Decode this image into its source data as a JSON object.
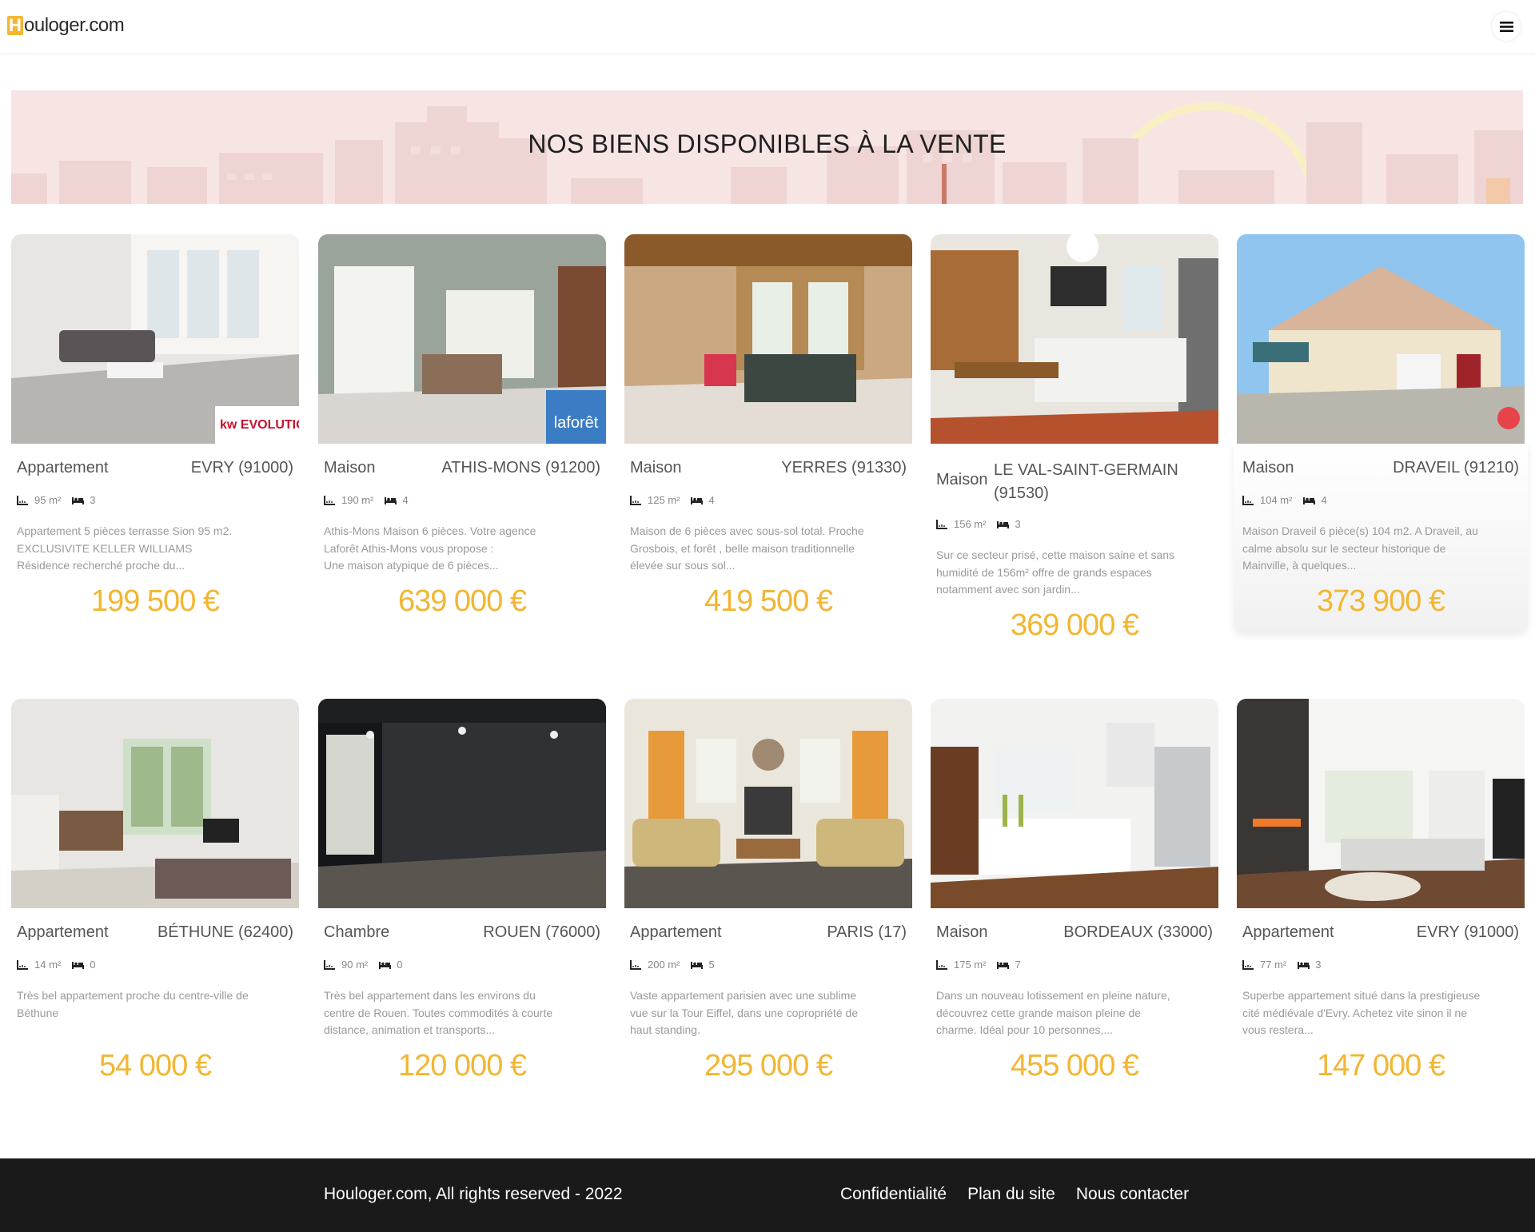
{
  "header": {
    "logo_mark": "H",
    "logo_text": "ouloger.com",
    "menu_icon": "hamburger-icon"
  },
  "banner": {
    "title": "NOS BIENS DISPONIBLES À LA VENTE"
  },
  "colors": {
    "accent": "#f2b632",
    "footer_bg": "#1a1a1a",
    "banner_bg": "#f7e4e3"
  },
  "listings": [
    {
      "type": "Appartement",
      "city": "EVRY (91000)",
      "area": "95 m²",
      "rooms": "3",
      "desc": [
        "Appartement 5 pièces terrasse Sion 95 m2.",
        "EXCLUSIVITE KELLER WILLIAMS",
        "Résidence recherché proche du..."
      ],
      "price": "199 500 €",
      "badge": "kw EVOLUTION"
    },
    {
      "type": "Maison",
      "city": "ATHIS-MONS (91200)",
      "area": "190 m²",
      "rooms": "4",
      "desc": [
        "Athis-Mons Maison 6 pièces. Votre agence",
        "Laforêt Athis-Mons vous propose :",
        "Une maison atypique de 6 pièces..."
      ],
      "price": "639 000 €",
      "badge": "laforêt"
    },
    {
      "type": "Maison",
      "city": "YERRES (91330)",
      "area": "125 m²",
      "rooms": "4",
      "desc": [
        "Maison de 6 pièces avec sous-sol total. Proche",
        "Grosbois, et forêt , belle maison traditionnelle",
        "élevée sur sous sol..."
      ],
      "price": "419 500 €"
    },
    {
      "type": "Maison",
      "city": "LE VAL-SAINT-GERMAIN (91530)",
      "area": "156 m²",
      "rooms": "3",
      "desc": [
        "Sur ce secteur prisé, cette maison saine et sans",
        "humidité de 156m² offre de grands espaces",
        "notamment avec son jardin..."
      ],
      "price": "369 000 €"
    },
    {
      "type": "Maison",
      "city": "DRAVEIL (91210)",
      "area": "104 m²",
      "rooms": "4",
      "desc": [
        "Maison Draveil 6 pièce(s) 104 m2. A Draveil, au",
        "calme absolu sur le secteur historique de",
        "Mainville, à quelques..."
      ],
      "price": "373 900 €"
    },
    {
      "type": "Appartement",
      "city": "BÉTHUNE (62400)",
      "area": "14 m²",
      "rooms": "0",
      "desc": [
        "Très bel appartement proche du centre-ville de",
        "Béthune"
      ],
      "price": "54 000 €"
    },
    {
      "type": "Chambre",
      "city": "ROUEN (76000)",
      "area": "90 m²",
      "rooms": "0",
      "desc": [
        "Très bel appartement dans les environs du",
        "centre de Rouen. Toutes commodités à courte",
        "distance, animation et transports..."
      ],
      "price": "120 000 €"
    },
    {
      "type": "Appartement",
      "city": "PARIS (17)",
      "area": "200 m²",
      "rooms": "5",
      "desc": [
        "Vaste appartement parisien avec une sublime",
        "vue sur la Tour Eiffel, dans une copropriété de",
        "haut standing."
      ],
      "price": "295 000 €"
    },
    {
      "type": "Maison",
      "city": "BORDEAUX (33000)",
      "area": "175 m²",
      "rooms": "7",
      "desc": [
        "Dans un nouveau lotissement en pleine nature,",
        "découvrez cette grande maison pleine de",
        "charme. Idéal pour 10 personnes,..."
      ],
      "price": "455 000 €"
    },
    {
      "type": "Appartement",
      "city": "EVRY (91000)",
      "area": "77 m²",
      "rooms": "3",
      "desc": [
        "Superbe appartement situé dans la prestigieuse",
        "cité médiévale d'Evry. Achetez vite sinon il ne",
        "vous restera..."
      ],
      "price": "147 000 €"
    }
  ],
  "footer": {
    "copyright": "Houloger.com, All rights reserved - 2022",
    "links": [
      "Confidentialité",
      "Plan du site",
      "Nous contacter"
    ]
  }
}
